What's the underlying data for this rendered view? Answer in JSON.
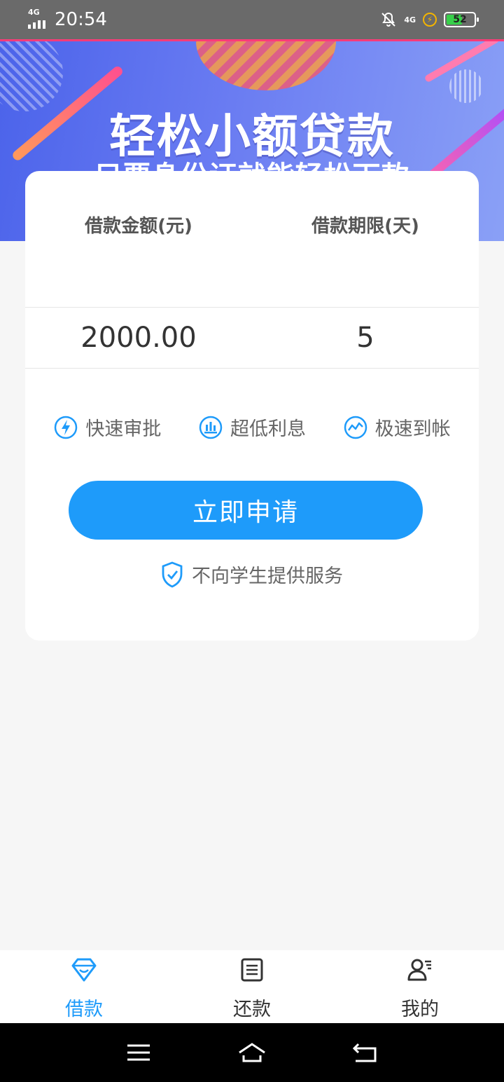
{
  "status_bar": {
    "network": "4G",
    "time": "20:54",
    "network_right": "4G",
    "battery": "52"
  },
  "banner": {
    "title": "轻松小额贷款",
    "subtitle": "只要身份证就能轻松下款"
  },
  "loan_card": {
    "amount_label": "借款金额(元)",
    "term_label": "借款期限(天)",
    "amount_value": "2000.00",
    "term_value": "5",
    "features": [
      {
        "icon": "lightning-icon",
        "label": "快速审批"
      },
      {
        "icon": "bar-chart-icon",
        "label": "超低利息"
      },
      {
        "icon": "trend-icon",
        "label": "极速到帐"
      }
    ],
    "apply_button": "立即申请",
    "notice": "不向学生提供服务"
  },
  "bottom_nav": {
    "items": [
      {
        "label": "借款",
        "icon": "diamond-icon",
        "active": true
      },
      {
        "label": "还款",
        "icon": "bill-icon",
        "active": false
      },
      {
        "label": "我的",
        "icon": "user-icon",
        "active": false
      }
    ]
  },
  "colors": {
    "accent": "#1e9bfa",
    "background": "#f6f6f6",
    "status_bar": "#6a6a6a"
  }
}
